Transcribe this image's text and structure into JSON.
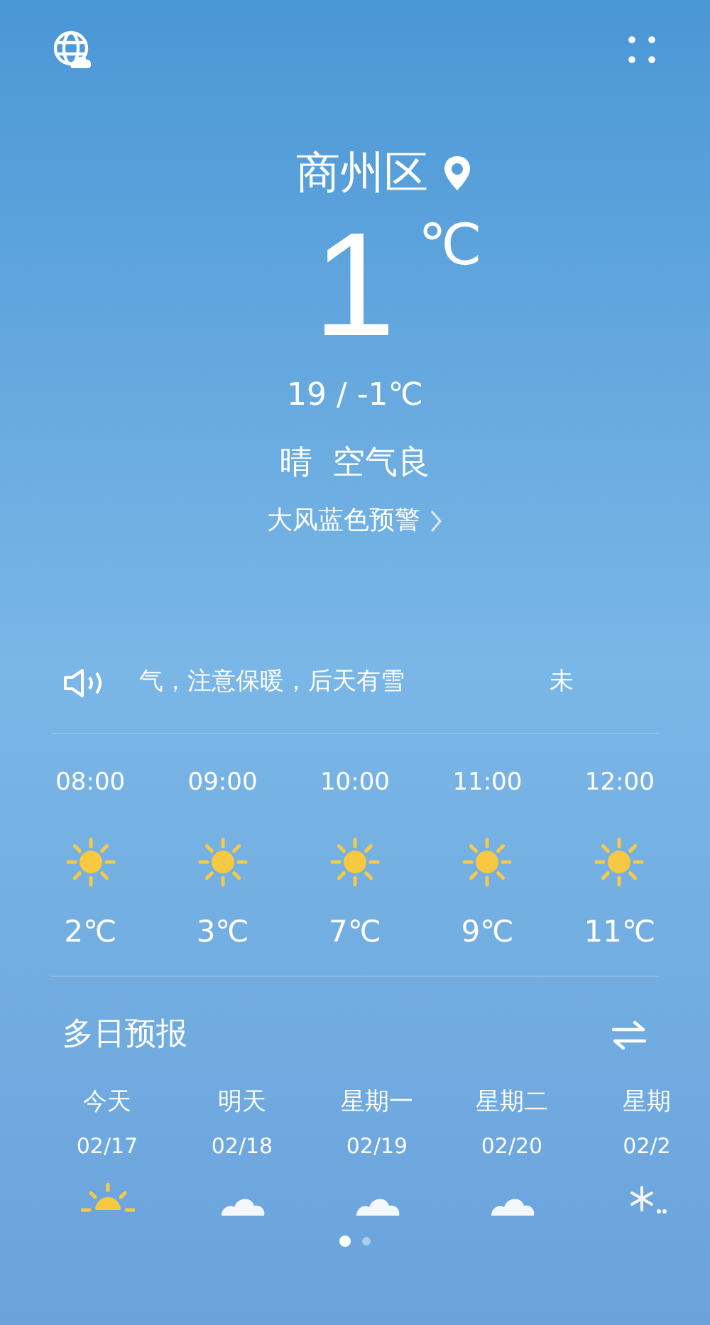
{
  "location": {
    "name": "商州区"
  },
  "current": {
    "temperature": "1",
    "unit": "℃",
    "range": "19 / -1℃",
    "condition": "晴",
    "air_quality": "空气良",
    "alert": "大风蓝色预警"
  },
  "ticker": {
    "text": "气，注意保暖，后天有雪",
    "next_text": "未"
  },
  "hourly": [
    {
      "time": "08:00",
      "kind": "sun",
      "temp": "2℃"
    },
    {
      "time": "09:00",
      "kind": "sun",
      "temp": "3℃"
    },
    {
      "time": "10:00",
      "kind": "sun",
      "temp": "7℃"
    },
    {
      "time": "11:00",
      "kind": "sun",
      "temp": "9℃"
    },
    {
      "time": "12:00",
      "kind": "sun",
      "temp": "11℃"
    }
  ],
  "forecast": {
    "title": "多日预报",
    "days": [
      {
        "day": "今天",
        "date": "02/17",
        "kind": "sunrise"
      },
      {
        "day": "明天",
        "date": "02/18",
        "kind": "cloud"
      },
      {
        "day": "星期一",
        "date": "02/19",
        "kind": "cloud"
      },
      {
        "day": "星期二",
        "date": "02/20",
        "kind": "cloud"
      },
      {
        "day": "星期",
        "date": "02/2",
        "kind": "snow"
      }
    ]
  },
  "pages": [
    {
      "selected": true
    },
    {
      "selected": false
    }
  ]
}
